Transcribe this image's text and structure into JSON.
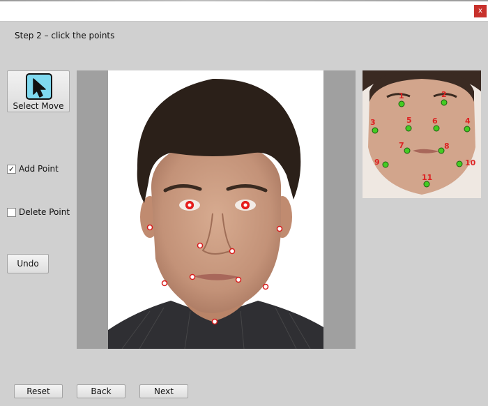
{
  "window": {
    "close_label": "x"
  },
  "step": {
    "title": "Step 2 – click the points"
  },
  "tool": {
    "select_move_label": "Select Move",
    "icon": "arrow-cursor-icon"
  },
  "options": {
    "add_point": {
      "label": "Add Point",
      "checked": true,
      "mark": "✓"
    },
    "delete_point": {
      "label": "Delete Point",
      "checked": false
    }
  },
  "actions": {
    "undo": "Undo",
    "reset": "Reset",
    "back": "Back",
    "next": "Next"
  },
  "reference": {
    "point_labels": [
      "1",
      "2",
      "3",
      "4",
      "5",
      "6",
      "7",
      "8",
      "9",
      "10",
      "11"
    ],
    "marker_color": "#44cc22",
    "label_color": "#dd2222"
  },
  "main_image": {
    "marker_color": "#d81b1b"
  }
}
